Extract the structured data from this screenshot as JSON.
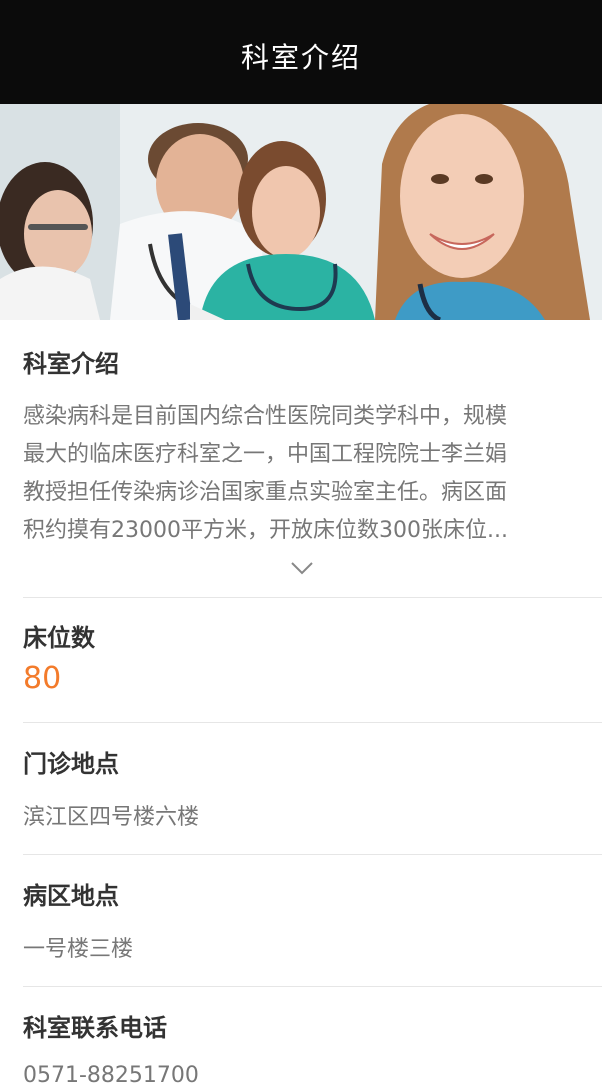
{
  "header": {
    "title": "科室介绍"
  },
  "banner": {
    "slides": 5,
    "active_index": 0
  },
  "intro": {
    "title": "科室介绍",
    "lines": [
      "感染病科是目前国内综合性医院同类学科中，规模",
      "最大的临床医疗科室之一，中国工程院院士李兰娟",
      "教授担任传染病诊治国家重点实验室主任。病区面",
      "积约摸有23000平方米，开放床位数300张床位..."
    ],
    "expand_icon": "chevron-down-icon"
  },
  "beds": {
    "title": "床位数",
    "value": "80"
  },
  "clinic_location": {
    "title": "门诊地点",
    "value": "滨江区四号楼六楼"
  },
  "ward_location": {
    "title": "病区地点",
    "value": "一号楼三楼"
  },
  "phone": {
    "title": "科室联系电话",
    "value": "0571-88251700"
  },
  "colors": {
    "accent": "#f37b2b",
    "topbar": "#0b0b0b"
  }
}
